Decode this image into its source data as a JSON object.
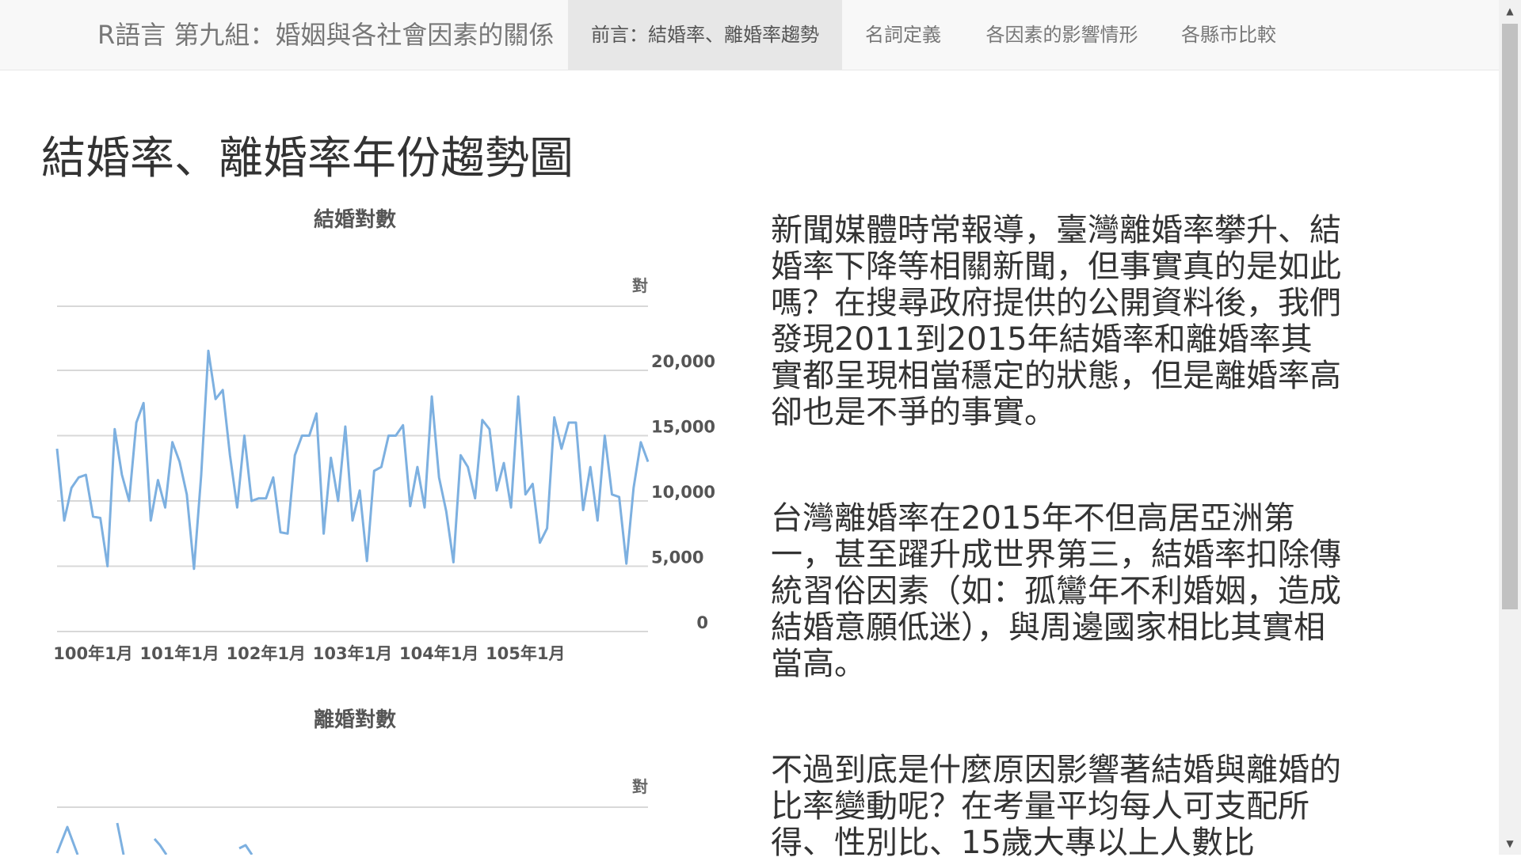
{
  "navbar": {
    "brand": "R語言 第九組：婚姻與各社會因素的關係",
    "items": [
      {
        "label": "前言：結婚率、離婚率趨勢",
        "active": true
      },
      {
        "label": "名詞定義",
        "active": false
      },
      {
        "label": "各因素的影響情形",
        "active": false
      },
      {
        "label": "各縣市比較",
        "active": false
      }
    ]
  },
  "page": {
    "title": "結婚率、離婚率年份趨勢圖"
  },
  "paragraphs": [
    "新聞媒體時常報導，臺灣離婚率攀升、結婚率下降等相關新聞，但事實真的是如此嗎？在搜尋政府提供的公開資料後，我們發現2011到2015年結婚率和離婚率其實都呈現相當穩定的狀態，但是離婚率高卻也是不爭的事實。",
    "台灣離婚率在2015年不但高居亞洲第一，甚至躍升成世界第三，結婚率扣除傳統習俗因素（如：孤鸞年不利婚姻，造成結婚意願低迷），與周邊國家相比其實相當高。",
    "不過到底是什麼原因影響著結婚與離婚的比率變動呢？在考量平均每人可支配所得、性別比、15歲大專以上人數比"
  ],
  "icons": {
    "scroll_up": "triangle-up-icon",
    "scroll_down": "triangle-down-icon"
  },
  "colors": {
    "line": "#7db0e0",
    "nav_active_bg": "#e7e7e7",
    "navbar_bg": "#f8f8f8"
  },
  "chart_data": [
    {
      "type": "line",
      "title": "結婚對數",
      "unit": "對",
      "ylim": [
        0,
        25000
      ],
      "yticks": [
        "0",
        "5,000",
        "10,000",
        "15,000",
        "20,000"
      ],
      "xtick_labels": [
        "100年1月",
        "101年1月",
        "102年1月",
        "103年1月",
        "104年1月",
        "105年1月"
      ],
      "grid": true,
      "series": [
        {
          "values": [
            14000,
            8500,
            11000,
            11800,
            12000,
            8800,
            8700,
            5000,
            15500,
            12000,
            10000,
            16000,
            17500,
            8500,
            11600,
            9500,
            14500,
            13000,
            10500,
            4800,
            12000,
            21500,
            17800,
            18500,
            13500,
            9500,
            15000,
            10000,
            10200,
            10200,
            11800,
            7600,
            7500,
            13500,
            15000,
            15000,
            16700,
            7500,
            13300,
            10000,
            15700,
            8500,
            10800,
            5400,
            12300,
            12600,
            15000,
            15000,
            15800,
            9600,
            12600,
            9500,
            18000,
            11800,
            9200,
            5300,
            13500,
            12600,
            10200,
            16200,
            15500,
            10800,
            12900,
            9500,
            18000,
            10500,
            11300,
            6800,
            7900,
            16400,
            14000,
            16000,
            16000,
            9300,
            12600,
            8500,
            15000,
            10500,
            10300,
            5200,
            11000,
            14500,
            13000
          ]
        }
      ]
    },
    {
      "type": "line",
      "title": "離婚對數",
      "unit": "對",
      "grid": true
    }
  ]
}
